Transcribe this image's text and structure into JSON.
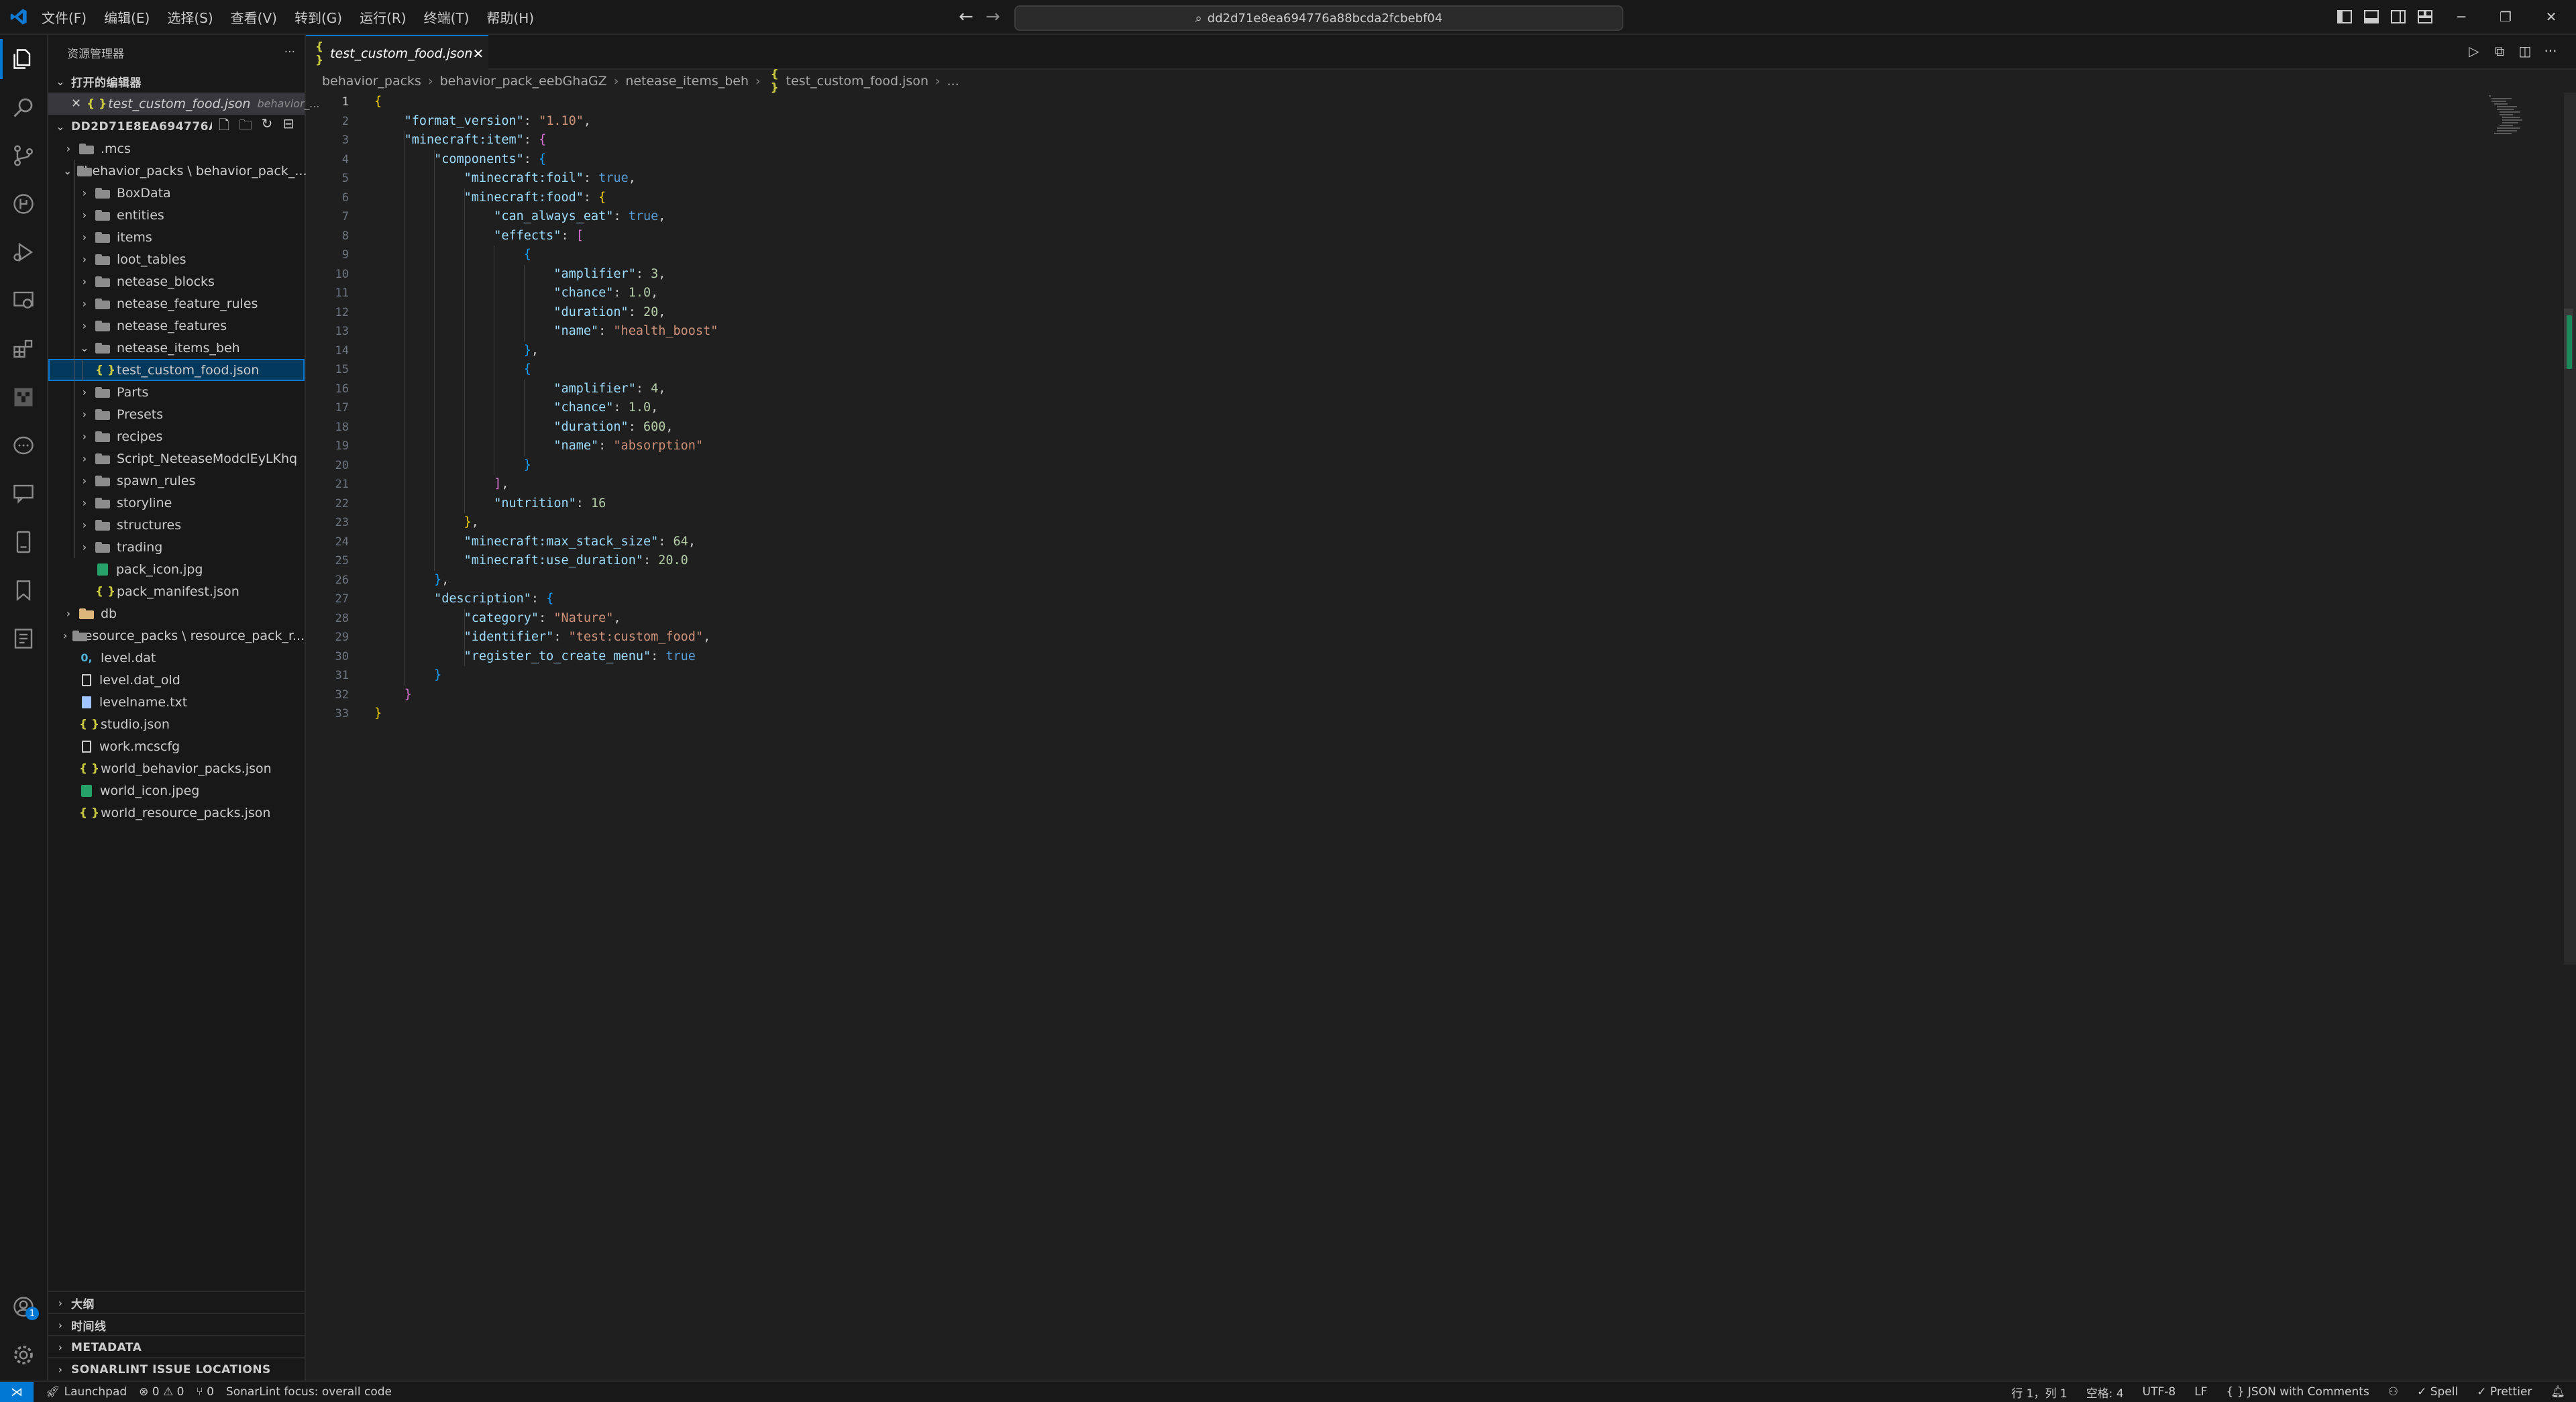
{
  "menu": [
    "文件(F)",
    "编辑(E)",
    "选择(S)",
    "查看(V)",
    "转到(G)",
    "运行(R)",
    "终端(T)",
    "帮助(H)"
  ],
  "command_center": {
    "text": "dd2d71e8ea694776a88bcda2fcbebf04"
  },
  "sidebar": {
    "title": "资源管理器",
    "more": "···",
    "open_editors_title": "打开的编辑器",
    "open_editor_file": "test_custom_food.json",
    "open_editor_path": "behavior_...",
    "workspace_title": "DD2D71E8EA694776A88...",
    "tree": [
      {
        "label": ".mcs",
        "type": "folder",
        "depth": 1,
        "state": "collapsed"
      },
      {
        "label": "behavior_packs \\ behavior_pack_...",
        "type": "folder",
        "depth": 1,
        "state": "expanded"
      },
      {
        "label": "BoxData",
        "type": "folder",
        "depth": 2,
        "state": "collapsed"
      },
      {
        "label": "entities",
        "type": "folder",
        "depth": 2,
        "state": "collapsed"
      },
      {
        "label": "items",
        "type": "folder",
        "depth": 2,
        "state": "collapsed"
      },
      {
        "label": "loot_tables",
        "type": "folder",
        "depth": 2,
        "state": "collapsed"
      },
      {
        "label": "netease_blocks",
        "type": "folder",
        "depth": 2,
        "state": "collapsed"
      },
      {
        "label": "netease_feature_rules",
        "type": "folder",
        "depth": 2,
        "state": "collapsed"
      },
      {
        "label": "netease_features",
        "type": "folder",
        "depth": 2,
        "state": "collapsed"
      },
      {
        "label": "netease_items_beh",
        "type": "folder",
        "depth": 2,
        "state": "expanded"
      },
      {
        "label": "test_custom_food.json",
        "type": "json",
        "depth": 3,
        "state": "selected"
      },
      {
        "label": "Parts",
        "type": "folder",
        "depth": 2,
        "state": "collapsed"
      },
      {
        "label": "Presets",
        "type": "folder",
        "depth": 2,
        "state": "collapsed"
      },
      {
        "label": "recipes",
        "type": "folder",
        "depth": 2,
        "state": "collapsed"
      },
      {
        "label": "Script_NeteaseModclEyLKhq",
        "type": "folder",
        "depth": 2,
        "state": "collapsed"
      },
      {
        "label": "spawn_rules",
        "type": "folder",
        "depth": 2,
        "state": "collapsed"
      },
      {
        "label": "storyline",
        "type": "folder",
        "depth": 2,
        "state": "collapsed"
      },
      {
        "label": "structures",
        "type": "folder",
        "depth": 2,
        "state": "collapsed"
      },
      {
        "label": "trading",
        "type": "folder",
        "depth": 2,
        "state": "collapsed"
      },
      {
        "label": "pack_icon.jpg",
        "type": "image",
        "depth": 2,
        "state": "file"
      },
      {
        "label": "pack_manifest.json",
        "type": "json",
        "depth": 2,
        "state": "file"
      },
      {
        "label": "db",
        "type": "folder-yellow",
        "depth": 1,
        "state": "collapsed"
      },
      {
        "label": "resource_packs \\ resource_pack_r...",
        "type": "folder",
        "depth": 1,
        "state": "collapsed"
      },
      {
        "label": "level.dat",
        "type": "dat",
        "depth": 1,
        "state": "file"
      },
      {
        "label": "level.dat_old",
        "type": "file",
        "depth": 1,
        "state": "file"
      },
      {
        "label": "levelname.txt",
        "type": "txt",
        "depth": 1,
        "state": "file"
      },
      {
        "label": "studio.json",
        "type": "json",
        "depth": 1,
        "state": "file"
      },
      {
        "label": "work.mcscfg",
        "type": "file",
        "depth": 1,
        "state": "file"
      },
      {
        "label": "world_behavior_packs.json",
        "type": "json",
        "depth": 1,
        "state": "file"
      },
      {
        "label": "world_icon.jpeg",
        "type": "image",
        "depth": 1,
        "state": "file"
      },
      {
        "label": "world_resource_packs.json",
        "type": "json",
        "depth": 1,
        "state": "file"
      }
    ],
    "bottom_sections": [
      "大纲",
      "时间线",
      "METADATA",
      "SONARLINT ISSUE LOCATIONS"
    ]
  },
  "editor": {
    "tab_label": "test_custom_food.json",
    "breadcrumb": [
      "behavior_packs",
      "behavior_pack_eebGhaGZ",
      "netease_items_beh",
      "test_custom_food.json",
      "..."
    ],
    "current_line": 1,
    "lines": [
      [
        [
          "br1",
          "{"
        ]
      ],
      [
        [
          "p",
          "    "
        ],
        [
          "k",
          "\"format_version\""
        ],
        [
          "p",
          ": "
        ],
        [
          "s",
          "\"1.10\""
        ],
        [
          "p",
          ","
        ]
      ],
      [
        [
          "p",
          "    "
        ],
        [
          "k",
          "\"minecraft:item\""
        ],
        [
          "p",
          ": "
        ],
        [
          "br2",
          "{"
        ]
      ],
      [
        [
          "p",
          "        "
        ],
        [
          "k",
          "\"components\""
        ],
        [
          "p",
          ": "
        ],
        [
          "br3",
          "{"
        ]
      ],
      [
        [
          "p",
          "            "
        ],
        [
          "k",
          "\"minecraft:foil\""
        ],
        [
          "p",
          ": "
        ],
        [
          "b",
          "true"
        ],
        [
          "p",
          ","
        ]
      ],
      [
        [
          "p",
          "            "
        ],
        [
          "k",
          "\"minecraft:food\""
        ],
        [
          "p",
          ": "
        ],
        [
          "br1",
          "{"
        ]
      ],
      [
        [
          "p",
          "                "
        ],
        [
          "k",
          "\"can_always_eat\""
        ],
        [
          "p",
          ": "
        ],
        [
          "b",
          "true"
        ],
        [
          "p",
          ","
        ]
      ],
      [
        [
          "p",
          "                "
        ],
        [
          "k",
          "\"effects\""
        ],
        [
          "p",
          ": "
        ],
        [
          "br2",
          "["
        ]
      ],
      [
        [
          "p",
          "                    "
        ],
        [
          "br3",
          "{"
        ]
      ],
      [
        [
          "p",
          "                        "
        ],
        [
          "k",
          "\"amplifier\""
        ],
        [
          "p",
          ": "
        ],
        [
          "n",
          "3"
        ],
        [
          "p",
          ","
        ]
      ],
      [
        [
          "p",
          "                        "
        ],
        [
          "k",
          "\"chance\""
        ],
        [
          "p",
          ": "
        ],
        [
          "n",
          "1.0"
        ],
        [
          "p",
          ","
        ]
      ],
      [
        [
          "p",
          "                        "
        ],
        [
          "k",
          "\"duration\""
        ],
        [
          "p",
          ": "
        ],
        [
          "n",
          "20"
        ],
        [
          "p",
          ","
        ]
      ],
      [
        [
          "p",
          "                        "
        ],
        [
          "k",
          "\"name\""
        ],
        [
          "p",
          ": "
        ],
        [
          "s",
          "\"health_boost\""
        ]
      ],
      [
        [
          "p",
          "                    "
        ],
        [
          "br3",
          "}"
        ],
        [
          "p",
          ","
        ]
      ],
      [
        [
          "p",
          "                    "
        ],
        [
          "br3",
          "{"
        ]
      ],
      [
        [
          "p",
          "                        "
        ],
        [
          "k",
          "\"amplifier\""
        ],
        [
          "p",
          ": "
        ],
        [
          "n",
          "4"
        ],
        [
          "p",
          ","
        ]
      ],
      [
        [
          "p",
          "                        "
        ],
        [
          "k",
          "\"chance\""
        ],
        [
          "p",
          ": "
        ],
        [
          "n",
          "1.0"
        ],
        [
          "p",
          ","
        ]
      ],
      [
        [
          "p",
          "                        "
        ],
        [
          "k",
          "\"duration\""
        ],
        [
          "p",
          ": "
        ],
        [
          "n",
          "600"
        ],
        [
          "p",
          ","
        ]
      ],
      [
        [
          "p",
          "                        "
        ],
        [
          "k",
          "\"name\""
        ],
        [
          "p",
          ": "
        ],
        [
          "s",
          "\"absorption\""
        ]
      ],
      [
        [
          "p",
          "                    "
        ],
        [
          "br3",
          "}"
        ]
      ],
      [
        [
          "p",
          "                "
        ],
        [
          "br2",
          "]"
        ],
        [
          "p",
          ","
        ]
      ],
      [
        [
          "p",
          "                "
        ],
        [
          "k",
          "\"nutrition\""
        ],
        [
          "p",
          ": "
        ],
        [
          "n",
          "16"
        ]
      ],
      [
        [
          "p",
          "            "
        ],
        [
          "br1",
          "}"
        ],
        [
          "p",
          ","
        ]
      ],
      [
        [
          "p",
          "            "
        ],
        [
          "k",
          "\"minecraft:max_stack_size\""
        ],
        [
          "p",
          ": "
        ],
        [
          "n",
          "64"
        ],
        [
          "p",
          ","
        ]
      ],
      [
        [
          "p",
          "            "
        ],
        [
          "k",
          "\"minecraft:use_duration\""
        ],
        [
          "p",
          ": "
        ],
        [
          "n",
          "20.0"
        ]
      ],
      [
        [
          "p",
          "        "
        ],
        [
          "br3",
          "}"
        ],
        [
          "p",
          ","
        ]
      ],
      [
        [
          "p",
          "        "
        ],
        [
          "k",
          "\"description\""
        ],
        [
          "p",
          ": "
        ],
        [
          "br3",
          "{"
        ]
      ],
      [
        [
          "p",
          "            "
        ],
        [
          "k",
          "\"category\""
        ],
        [
          "p",
          ": "
        ],
        [
          "s",
          "\"Nature\""
        ],
        [
          "p",
          ","
        ]
      ],
      [
        [
          "p",
          "            "
        ],
        [
          "k",
          "\"identifier\""
        ],
        [
          "p",
          ": "
        ],
        [
          "s",
          "\"test:custom_food\""
        ],
        [
          "p",
          ","
        ]
      ],
      [
        [
          "p",
          "            "
        ],
        [
          "k",
          "\"register_to_create_menu\""
        ],
        [
          "p",
          ": "
        ],
        [
          "b",
          "true"
        ]
      ],
      [
        [
          "p",
          "        "
        ],
        [
          "br3",
          "}"
        ]
      ],
      [
        [
          "p",
          "    "
        ],
        [
          "br2",
          "}"
        ]
      ],
      [
        [
          "br1",
          "}"
        ]
      ]
    ]
  },
  "statusbar": {
    "remote": "⋊",
    "launchpad": "Launchpad",
    "errors": "⊗ 0 ⚠ 0",
    "ports": "⑂ 0",
    "sonarlint": "SonarLint focus: overall code",
    "position": "行 1，列 1",
    "spaces": "空格: 4",
    "encoding": "UTF-8",
    "eol": "LF",
    "language": "{ }  JSON with Comments",
    "spell": "✓ Spell",
    "prettier": "✓ Prettier"
  },
  "account_badge": "1",
  "colors": {
    "accent": "#0078d4",
    "bg": "#1f1f1f",
    "panel": "#181818"
  }
}
